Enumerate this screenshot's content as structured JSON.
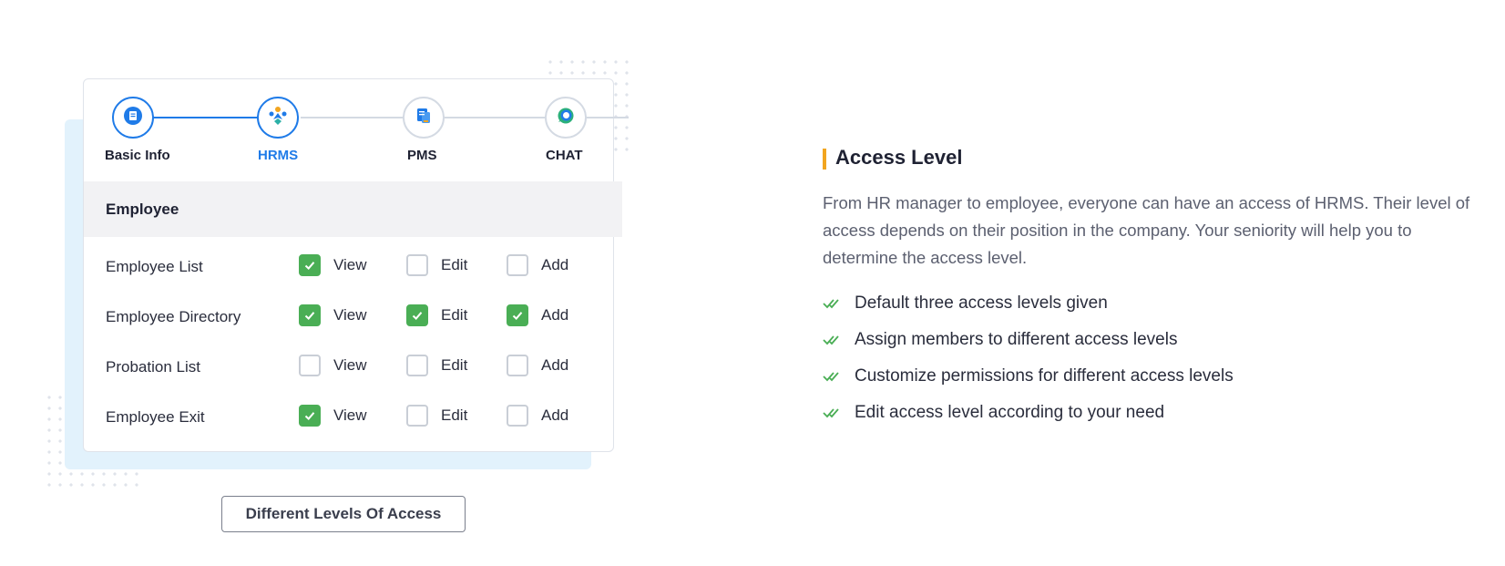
{
  "stepper": {
    "steps": [
      {
        "label": "Basic Info",
        "icon": "document-icon",
        "state": "completed"
      },
      {
        "label": "HRMS",
        "icon": "hrms-people-icon",
        "state": "active"
      },
      {
        "label": "PMS",
        "icon": "pms-files-icon",
        "state": "inactive"
      },
      {
        "label": "CHAT",
        "icon": "chat-bubble-icon",
        "state": "inactive"
      }
    ]
  },
  "section": {
    "title": "Employee"
  },
  "permissions": {
    "column_labels": {
      "view": "View",
      "edit": "Edit",
      "add": "Add"
    },
    "rows": [
      {
        "label": "Employee List",
        "view": true,
        "edit": false,
        "add": false
      },
      {
        "label": "Employee Directory",
        "view": true,
        "edit": true,
        "add": true
      },
      {
        "label": "Probation List",
        "view": false,
        "edit": false,
        "add": false
      },
      {
        "label": "Employee Exit",
        "view": true,
        "edit": false,
        "add": false
      }
    ]
  },
  "caption_button": {
    "label": "Different Levels Of Access"
  },
  "content": {
    "heading": "Access Level",
    "description": "From HR manager to employee, everyone can have an access of HRMS. Their level of access depends on their position in the company. Your seniority will help you to determine the access level.",
    "features": [
      "Default three access levels given",
      "Assign members to different access levels",
      "Customize permissions for different access levels",
      "Edit access level according to your need"
    ]
  },
  "colors": {
    "primary_blue": "#1f7be8",
    "check_green": "#4aae55",
    "accent_orange": "#f2a51f",
    "backdrop_blue": "#e2f2fc"
  }
}
